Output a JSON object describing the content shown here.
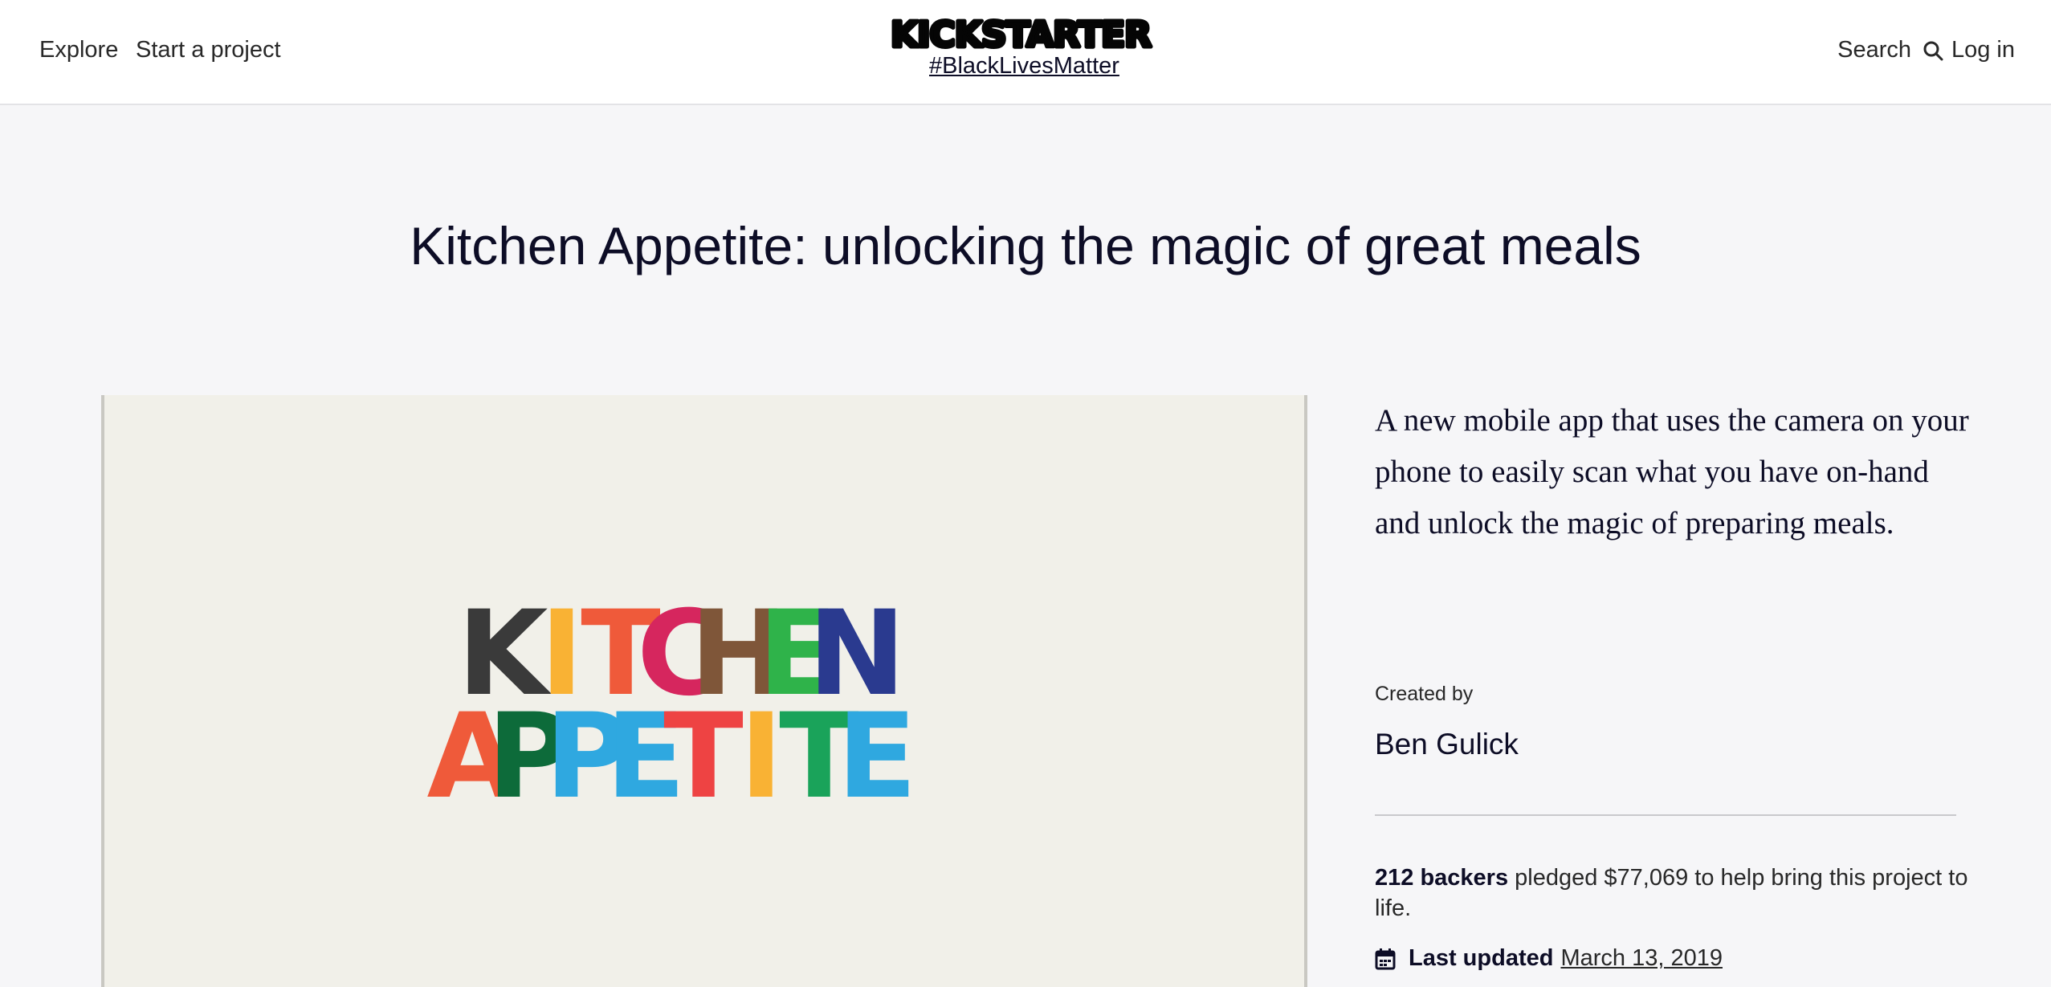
{
  "header": {
    "explore_label": "Explore",
    "start_project_label": "Start a project",
    "logo_text": "KICKSTARTER",
    "hashtag_link": "#BlackLivesMatter",
    "search_label": "Search",
    "login_label": "Log in"
  },
  "project": {
    "title": "Kitchen Appetite: unlocking the magic of great meals",
    "image_text_line1": "KITCHEN",
    "image_text_line2": "APPETITE",
    "blurb": "A new mobile app that uses the camera on your phone to easily scan what you have on-hand and unlock the magic of preparing meals.",
    "created_by_label": "Created by",
    "creator_name": "Ben Gulick",
    "backers_count": "212 backers",
    "pledge_text": " pledged $77,069 to help bring this project to life.",
    "last_updated_label": "Last updated",
    "last_updated_date": "March 13, 2019"
  },
  "colors": {
    "brand_text": "#0d0d26",
    "page_background": "#f6f6f8",
    "image_background": "#f1f0e9",
    "letter_colors": [
      "#3a3a3a",
      "#f9b234",
      "#ef5a3a",
      "#d6265e",
      "#7f5639",
      "#2fb34a",
      "#2a3a8f",
      "#ef5a3a",
      "#0d6b3a",
      "#2fa8e0",
      "#2fa8e0",
      "#ee4343",
      "#f9b234",
      "#1aa35a",
      "#2fa8e0",
      "#7f5639"
    ]
  },
  "icons": {
    "search": "search-icon",
    "calendar": "calendar-icon"
  }
}
